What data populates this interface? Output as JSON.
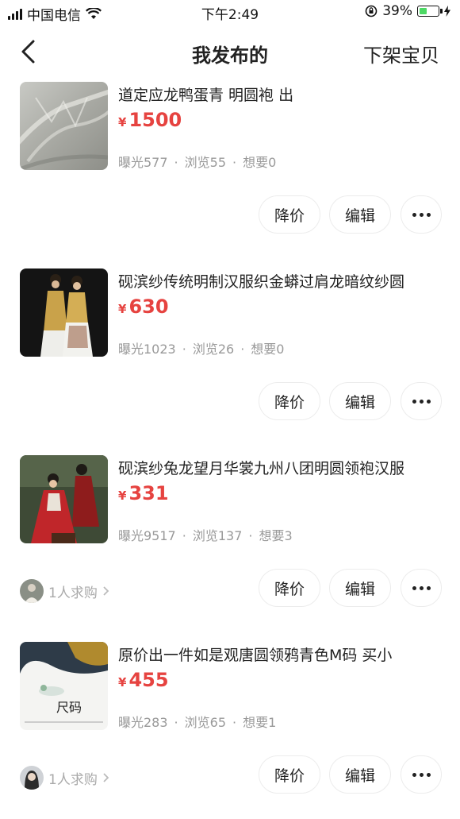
{
  "status_bar": {
    "carrier": "中国电信",
    "time": "下午2:49",
    "battery_percent": "39%",
    "battery_level": 0.39
  },
  "nav": {
    "title": "我发布的",
    "action": "下架宝贝"
  },
  "listings": [
    {
      "title": "道定应龙鸭蛋青 明圆袍 出",
      "currency": "¥",
      "price": "1500",
      "stats": {
        "exposure": "曝光577",
        "views": "浏览55",
        "wants": "想要0"
      },
      "buyer_text": "",
      "buttons": {
        "lower_price": "降价",
        "edit": "编辑"
      }
    },
    {
      "title": "砚滨纱传统明制汉服织金蟒过肩龙暗纹纱圆",
      "currency": "¥",
      "price": "630",
      "stats": {
        "exposure": "曝光1023",
        "views": "浏览26",
        "wants": "想要0"
      },
      "buyer_text": "",
      "buttons": {
        "lower_price": "降价",
        "edit": "编辑"
      }
    },
    {
      "title": "砚滨纱兔龙望月华裳九州八团明圆领袍汉服",
      "currency": "¥",
      "price": "331",
      "stats": {
        "exposure": "曝光9517",
        "views": "浏览137",
        "wants": "想要3"
      },
      "buyer_text": "1人求购",
      "buttons": {
        "lower_price": "降价",
        "edit": "编辑"
      }
    },
    {
      "title": "原价出一件如是观唐圆领鸦青色M码 买小",
      "currency": "¥",
      "price": "455",
      "stats": {
        "exposure": "曝光283",
        "views": "浏览65",
        "wants": "想要1"
      },
      "buyer_text": "1人求购",
      "thumb_label": "尺码",
      "buttons": {
        "lower_price": "降价",
        "edit": "编辑"
      }
    }
  ]
}
